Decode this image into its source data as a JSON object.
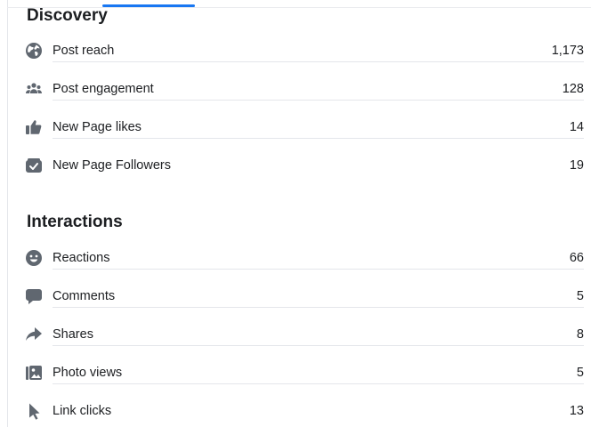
{
  "discovery": {
    "title": "Discovery",
    "items": [
      {
        "icon": "globe-icon",
        "label": "Post reach",
        "value": "1,173"
      },
      {
        "icon": "people-icon",
        "label": "Post engagement",
        "value": "128"
      },
      {
        "icon": "thumbs-up-icon",
        "label": "New Page likes",
        "value": "14"
      },
      {
        "icon": "follow-check-icon",
        "label": "New Page Followers",
        "value": "19"
      }
    ]
  },
  "interactions": {
    "title": "Interactions",
    "items": [
      {
        "icon": "smiley-icon",
        "label": "Reactions",
        "value": "66"
      },
      {
        "icon": "comment-bubble-icon",
        "label": "Comments",
        "value": "5"
      },
      {
        "icon": "share-arrow-icon",
        "label": "Shares",
        "value": "8"
      },
      {
        "icon": "photo-icon",
        "label": "Photo views",
        "value": "5"
      },
      {
        "icon": "cursor-icon",
        "label": "Link clicks",
        "value": "13"
      }
    ]
  },
  "colors": {
    "accent": "#1877f2",
    "icon": "#606770",
    "text": "#1c1e21",
    "divider": "#e4e6eb"
  }
}
